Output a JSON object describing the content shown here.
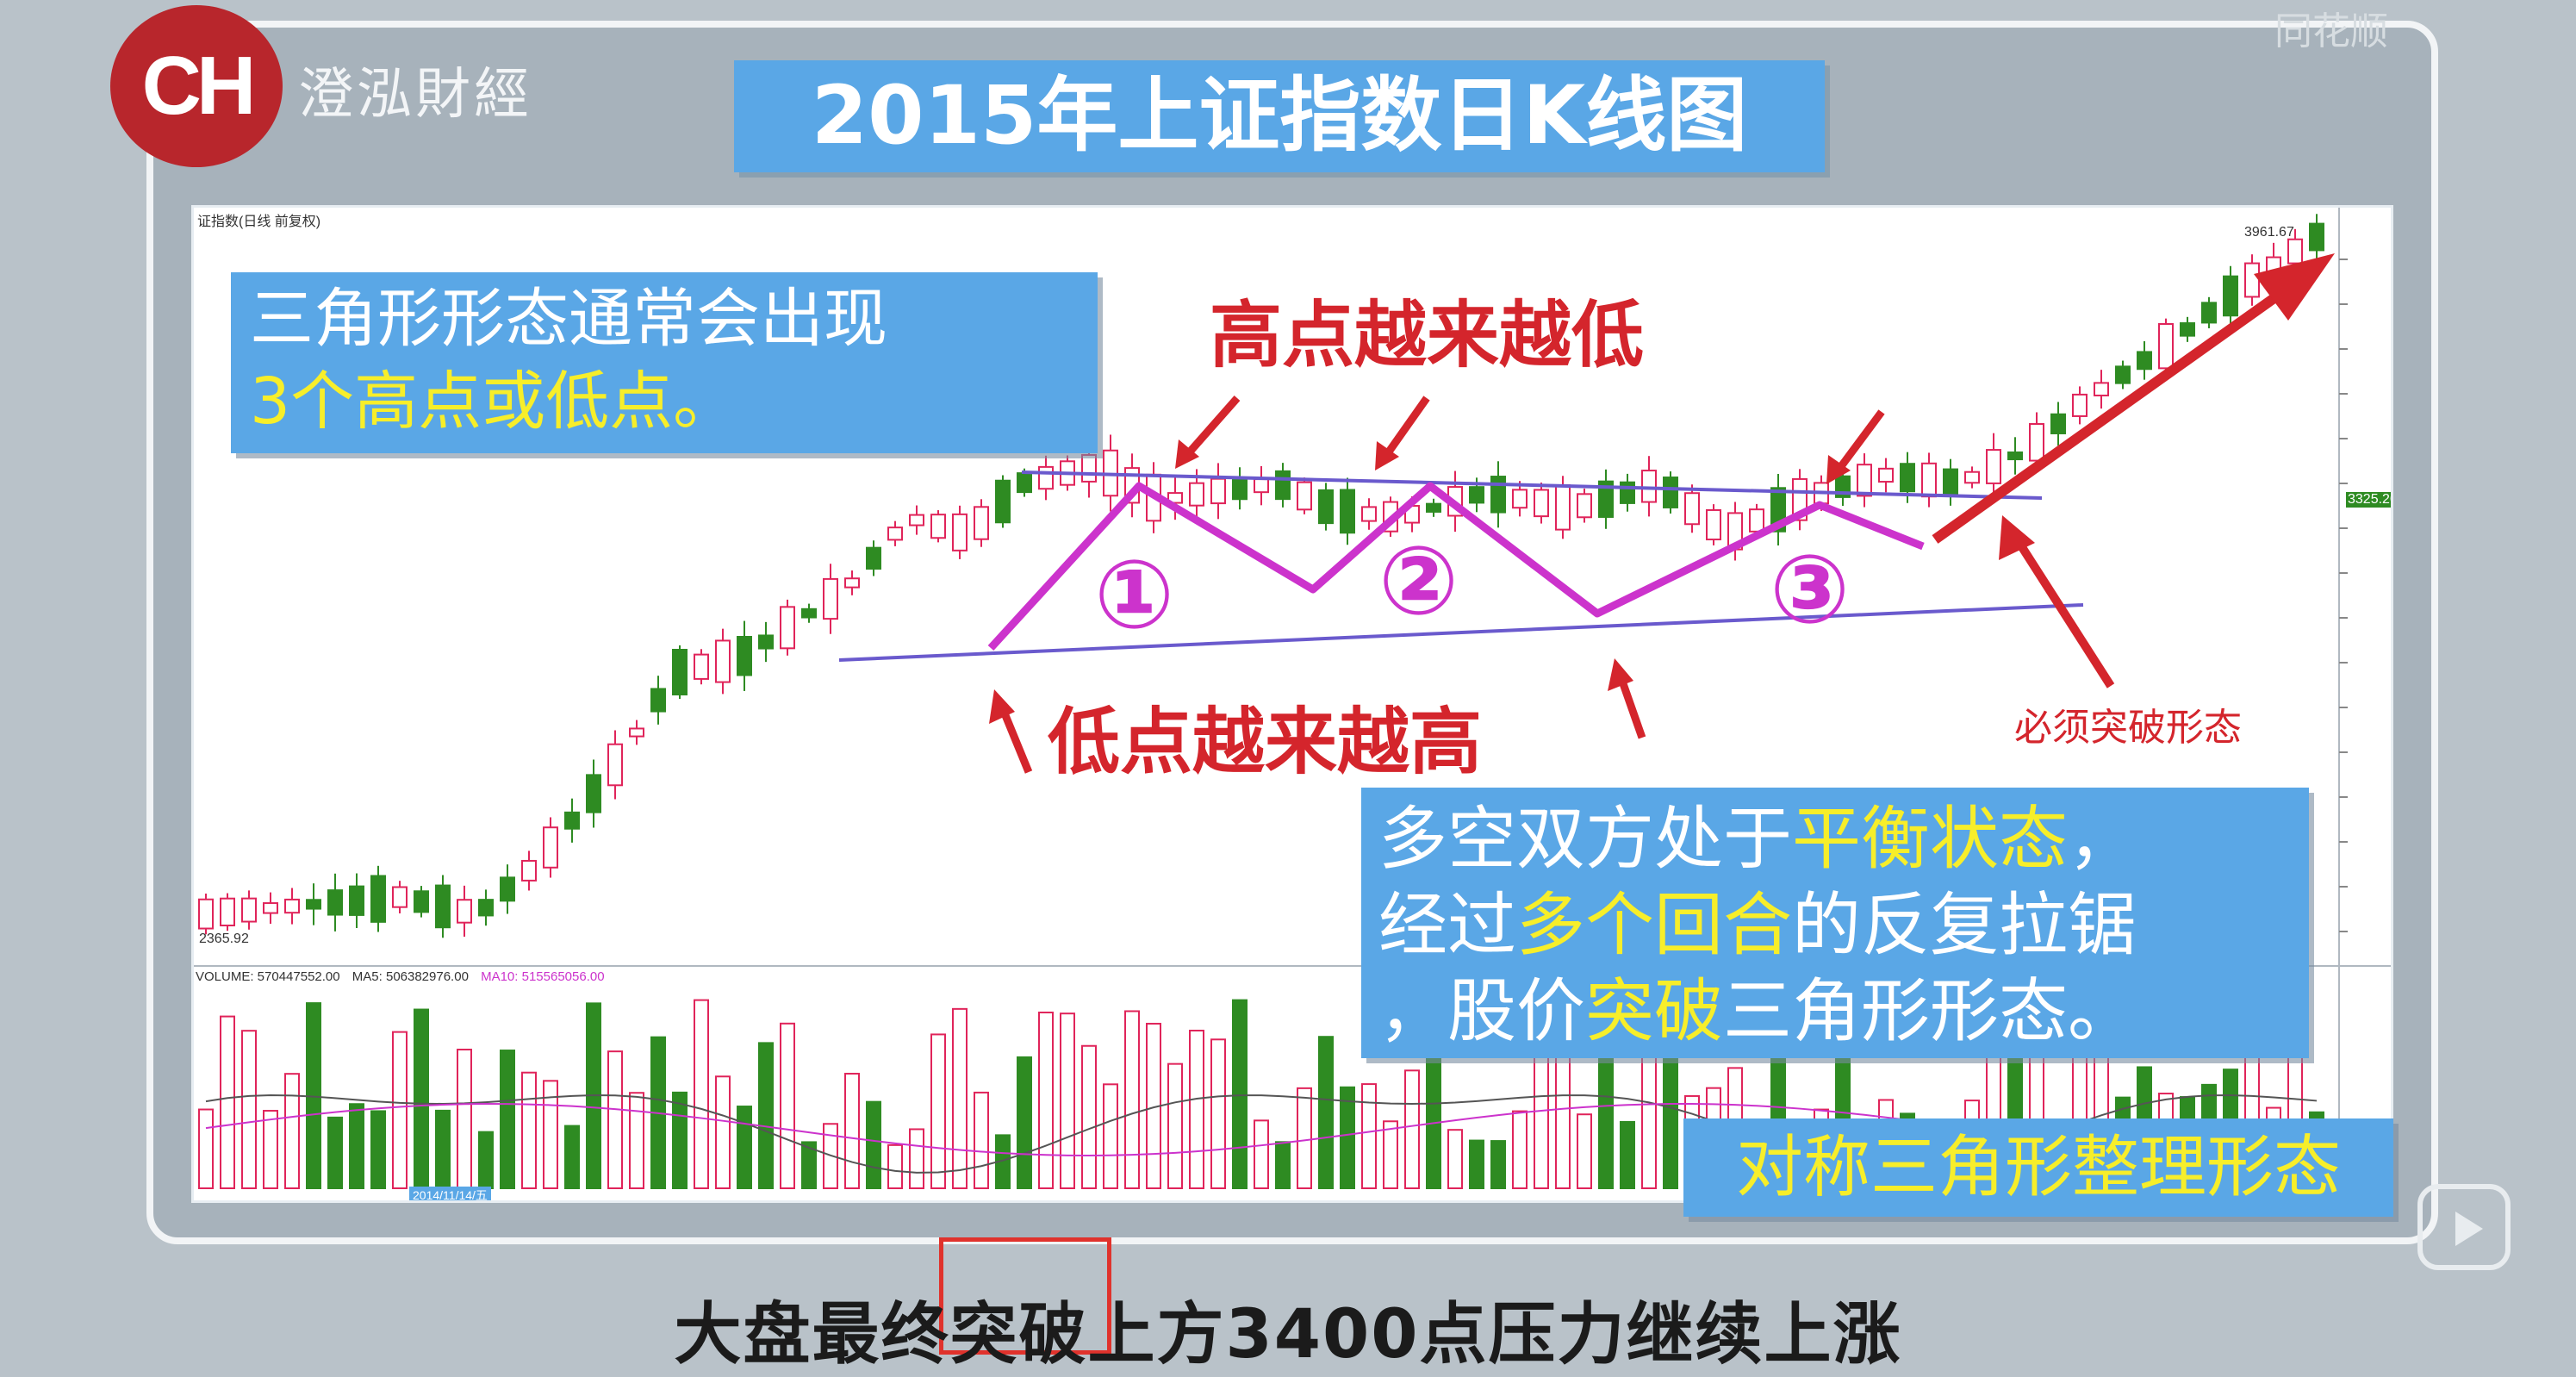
{
  "brand": {
    "logo_text": "CH",
    "name": "澄泓財經",
    "watermark": "同花顺"
  },
  "title": "2015年上证指数日K线图",
  "chart_header": "证指数(日线 前复权)",
  "price_max_label": "3961.67",
  "price_min_label": "2365.92",
  "current_price_tag": "3325.20",
  "volume_header": {
    "volume": "VOLUME: 570447552.00",
    "ma5": "MA5: 506382976.00",
    "ma10": "MA10: 515565056.00"
  },
  "date_label": "2014/11/14/五",
  "callouts": {
    "box1_line1": "三角形形态通常会出现",
    "box1_line2": "3个高点或低点。",
    "high_label": "高点越来越低",
    "low_label": "低点越来越高",
    "must_break": "必须突破形态",
    "box2_line1_a": "多空双方处于",
    "box2_line1_b": "平衡状态",
    "box2_line1_c": "，",
    "box2_line2_a": "经过",
    "box2_line2_b": "多个回合",
    "box2_line2_c": "的反复拉锯",
    "box2_line3_a": "，股价",
    "box2_line3_b": "突破",
    "box2_line3_c": "三角形形态。",
    "pattern_name": "对称三角形整理形态",
    "circle1": "①",
    "circle2": "②",
    "circle3": "③"
  },
  "subtitle": "大盘最终突破上方3400点压力继续上涨",
  "colors": {
    "up": "#e0245a",
    "down": "#2e8b22",
    "accent": "#5aa7e6",
    "highlight": "#f7ee2a",
    "magenta": "#cc33cc",
    "red": "#d4252c"
  }
}
